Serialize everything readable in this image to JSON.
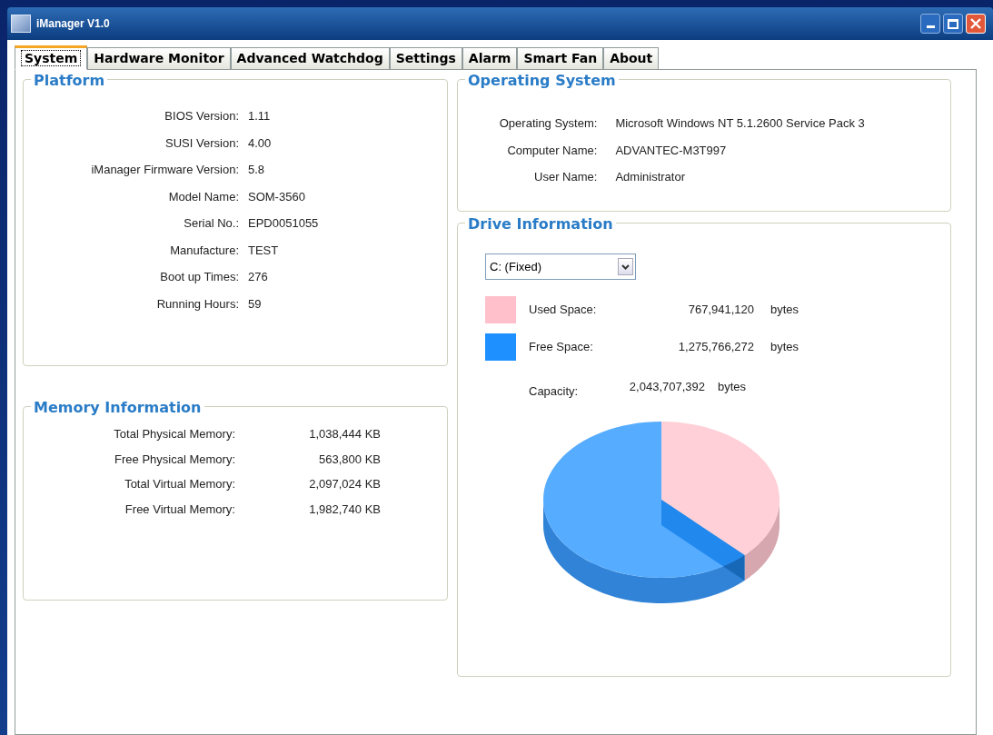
{
  "window": {
    "title": "iManager V1.0"
  },
  "tabs": [
    {
      "label": "System",
      "selected": true
    },
    {
      "label": "Hardware Monitor",
      "selected": false
    },
    {
      "label": "Advanced Watchdog",
      "selected": false
    },
    {
      "label": "Settings",
      "selected": false
    },
    {
      "label": "Alarm",
      "selected": false
    },
    {
      "label": "Smart Fan",
      "selected": false
    },
    {
      "label": "About",
      "selected": false
    }
  ],
  "platform": {
    "title": "Platform",
    "fields": [
      {
        "label": "BIOS Version:",
        "value": "1.11"
      },
      {
        "label": "SUSI Version:",
        "value": "4.00"
      },
      {
        "label": "iManager Firmware Version:",
        "value": "5.8"
      },
      {
        "label": "Model Name:",
        "value": "SOM-3560"
      },
      {
        "label": "Serial No.:",
        "value": "EPD0051055"
      },
      {
        "label": "Manufacture:",
        "value": "TEST"
      },
      {
        "label": "Boot up Times:",
        "value": "276"
      },
      {
        "label": "Running Hours:",
        "value": "59"
      }
    ]
  },
  "memory": {
    "title": "Memory Information",
    "fields": [
      {
        "label": "Total Physical Memory:",
        "value": "1,038,444 KB"
      },
      {
        "label": "Free Physical Memory:",
        "value": "563,800 KB"
      },
      {
        "label": "Total Virtual Memory:",
        "value": "2,097,024 KB"
      },
      {
        "label": "Free Virtual Memory:",
        "value": "1,982,740 KB"
      }
    ]
  },
  "operating_system": {
    "title": "Operating System",
    "fields": [
      {
        "label": "Operating System:",
        "value": "Microsoft Windows NT 5.1.2600 Service Pack 3"
      },
      {
        "label": "Computer Name:",
        "value": "ADVANTEC-M3T997"
      },
      {
        "label": "User Name:",
        "value": "Administrator"
      }
    ]
  },
  "drive_information": {
    "title": "Drive Information",
    "drive_select": {
      "value": "C: (Fixed)"
    },
    "legend": [
      {
        "label": "Used Space:",
        "value": "767,941,120",
        "unit": "bytes",
        "color": "#ffc0cb"
      },
      {
        "label": "Free Space:",
        "value": "1,275,766,272",
        "unit": "bytes",
        "color": "#1e90ff"
      }
    ],
    "capacity": {
      "label": "Capacity:",
      "value": "2,043,707,392",
      "unit": "bytes"
    }
  }
}
